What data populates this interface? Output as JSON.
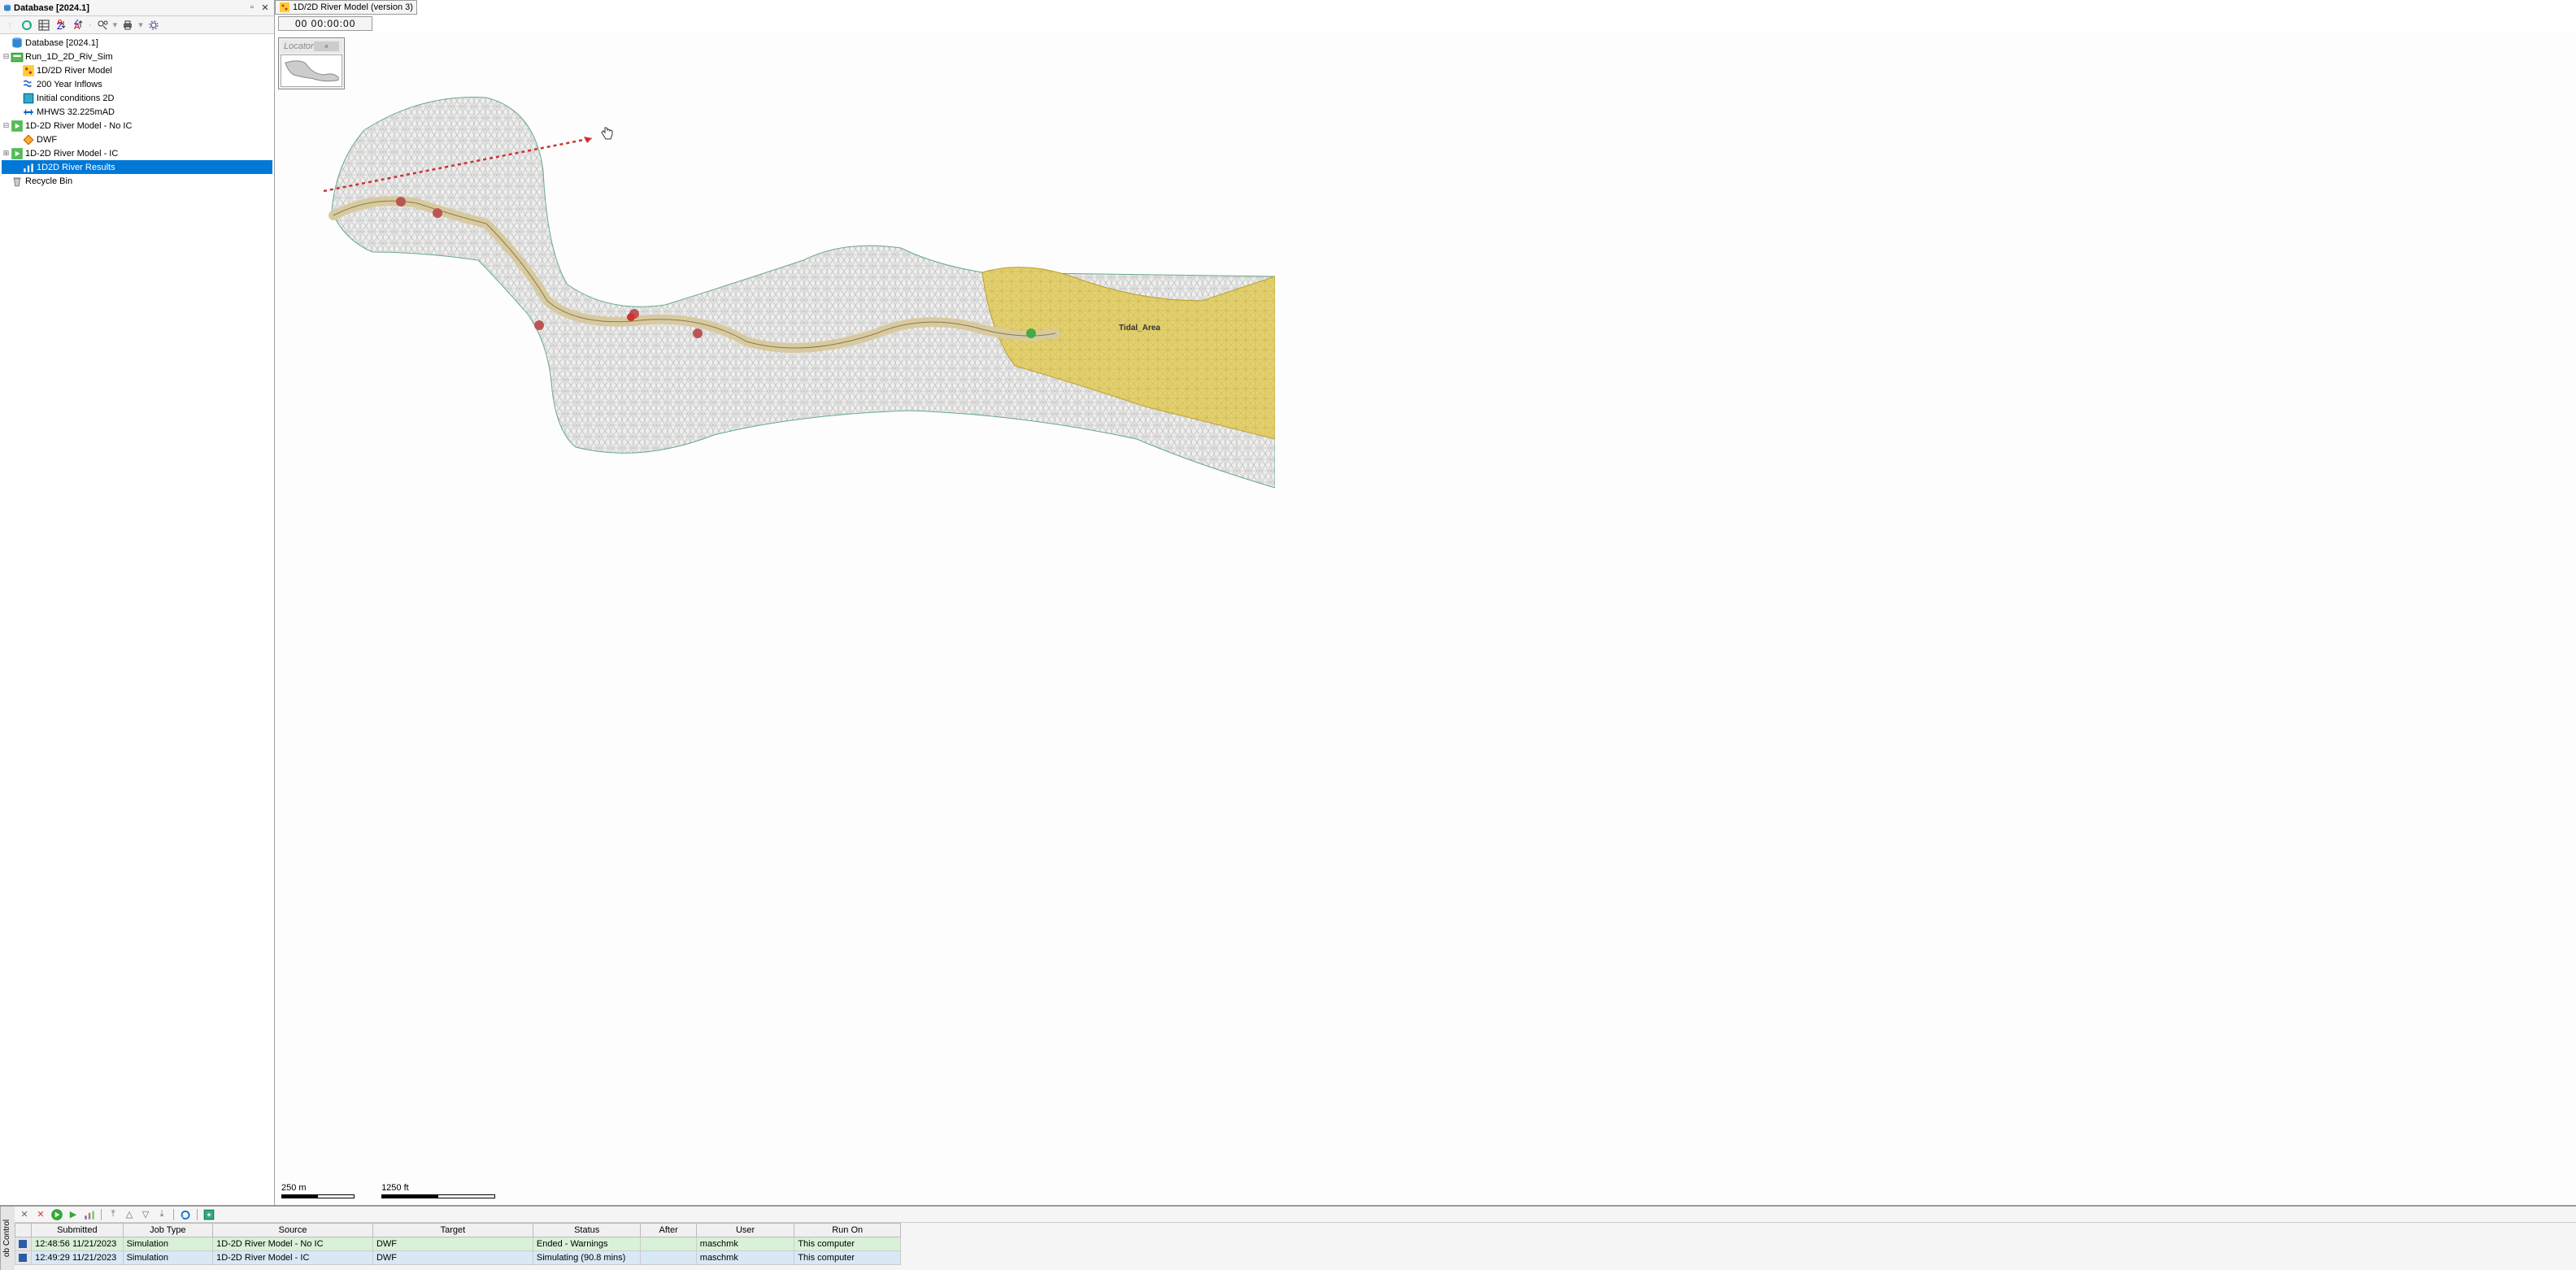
{
  "sidebar": {
    "title": "Database [2024.1]",
    "tree": {
      "root": {
        "label": "Database [2024.1]"
      },
      "sim_group": {
        "label": "Run_1D_2D_Riv_Sim"
      },
      "river_model": {
        "label": "1D/2D River Model"
      },
      "inflows": {
        "label": "200 Year Inflows"
      },
      "init_cond": {
        "label": "Initial conditions 2D"
      },
      "mhws": {
        "label": "MHWS 32.225mAD"
      },
      "model_no_ic": {
        "label": "1D-2D River Model - No IC"
      },
      "dwf": {
        "label": "DWF"
      },
      "model_ic": {
        "label": "1D-2D River Model - IC"
      },
      "results": {
        "label": "1D2D River Results"
      },
      "recycle": {
        "label": "Recycle Bin"
      }
    }
  },
  "main": {
    "tab_title": "1D/2D River Model (version 3)",
    "time_display": "00 00:00:00",
    "locator_title": "Locator",
    "tidal_label": "Tidal_Area",
    "scale_m": "250 m",
    "scale_ft": "1250 ft"
  },
  "bottom": {
    "side_tab": "ob Control",
    "columns": [
      "",
      "Submitted",
      "Job Type",
      "Source",
      "Target",
      "Status",
      "After",
      "User",
      "Run On"
    ],
    "rows": [
      {
        "submitted": "12:48:56 11/21/2023",
        "job_type": "Simulation",
        "source": "1D-2D River Model - No IC",
        "target": "DWF",
        "status": "Ended - Warnings",
        "after": "",
        "user": "maschmk",
        "run_on": "This computer",
        "class": "done"
      },
      {
        "submitted": "12:49:29 11/21/2023",
        "job_type": "Simulation",
        "source": "1D-2D River Model - IC",
        "target": "DWF",
        "status": "Simulating (90.8 mins)",
        "after": "",
        "user": "maschmk",
        "run_on": "This computer",
        "class": "running"
      }
    ]
  }
}
